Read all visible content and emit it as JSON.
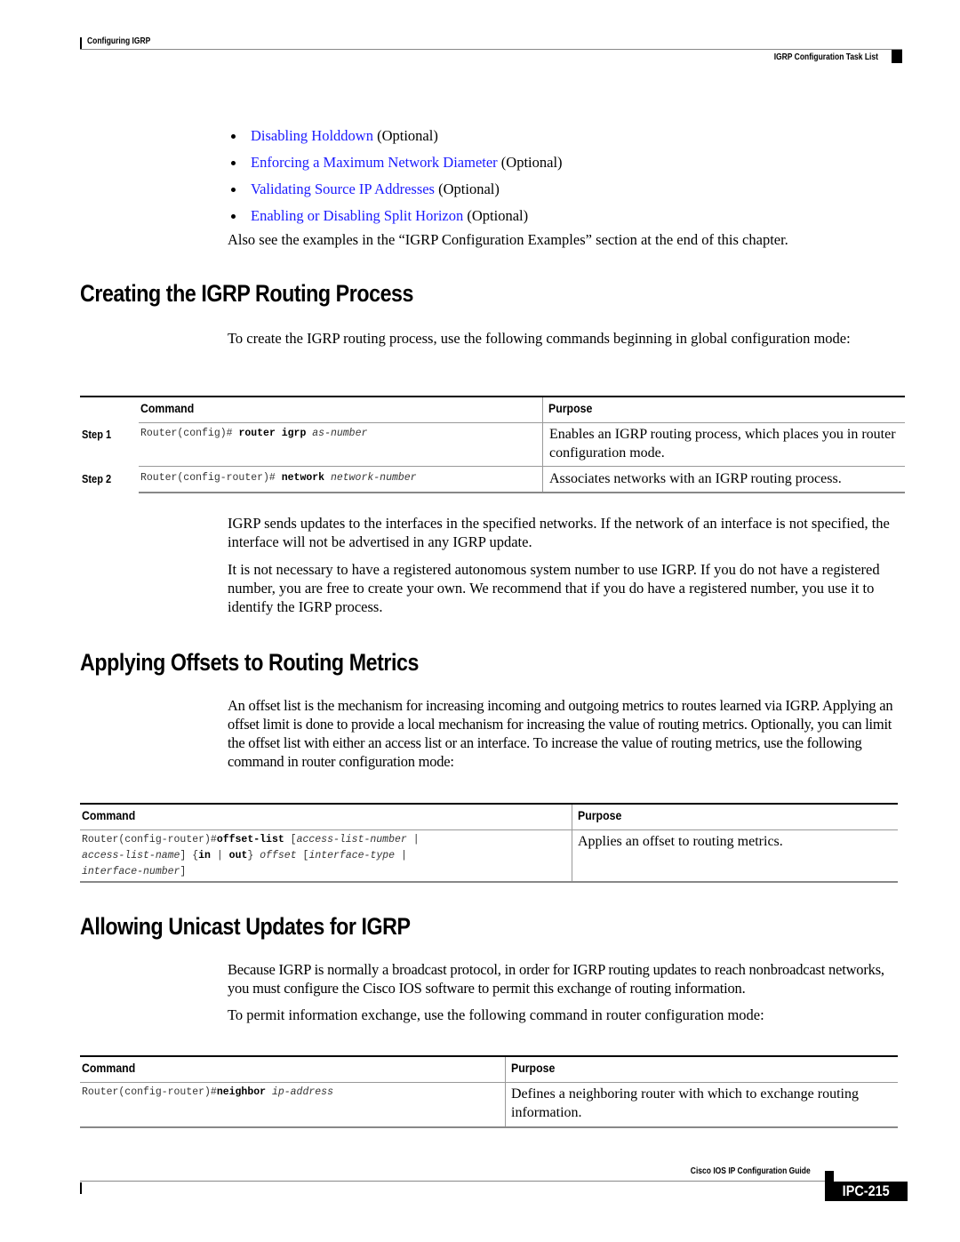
{
  "header": {
    "chapter": "Configuring IGRP",
    "section": "IGRP Configuration Task List"
  },
  "task_list": [
    {
      "link": "Disabling Holddown",
      "suffix": " (Optional)"
    },
    {
      "link": "Enforcing a Maximum Network Diameter",
      "suffix": " (Optional)"
    },
    {
      "link": "Validating Source IP Addresses",
      "suffix": " (Optional)"
    },
    {
      "link": "Enabling or Disabling Split Horizon",
      "suffix": " (Optional)"
    }
  ],
  "intro_note": "Also see the examples in the “IGRP Configuration Examples” section at the end of this chapter.",
  "sections": [
    {
      "title": "Creating the IGRP Routing Process",
      "intro": "To create the IGRP routing process, use the following commands beginning in global configuration mode:",
      "table": {
        "col_command": "Command",
        "col_purpose": "Purpose",
        "rows": [
          {
            "step": "Step 1",
            "prompt": "Router(config)#",
            "keyword": "router igrp",
            "arg": "as-number",
            "purpose": "Enables an IGRP routing process, which places you in router configuration mode."
          },
          {
            "step": "Step 2",
            "prompt": "Router(config-router)#",
            "keyword": "network",
            "arg": "network-number",
            "purpose": "Associates networks with an IGRP routing process."
          }
        ]
      },
      "after": [
        "IGRP sends updates to the interfaces in the specified networks. If the network of an interface is not specified, the interface will not be advertised in any IGRP update.",
        "It is not necessary to have a registered autonomous system number to use IGRP. If you do not have a registered number, you are free to create your own. We recommend that if you do have a registered number, you use it to identify the IGRP process."
      ]
    },
    {
      "title": "Applying Offsets to Routing Metrics",
      "intro": "An offset list is the mechanism for increasing incoming and outgoing metrics to routes learned via IGRP. Applying an offset limit is done to provide a local mechanism for increasing the value of routing metrics. Optionally, you can limit the offset list with either an access list or an interface. To increase the value of routing metrics, use the following command in router configuration mode:",
      "table": {
        "col_command": "Command",
        "col_purpose": "Purpose",
        "rows": [
          {
            "prompt": "Router(config-router)#",
            "keyword": "offset-list",
            "line1_rest": "access-list-number",
            "line2_a": "access-list-name",
            "kw_in": "in",
            "kw_out": "out",
            "arg_offset": "offset",
            "arg_iftype": "interface-type",
            "line3": "interface-number",
            "purpose": "Applies an offset to routing metrics."
          }
        ]
      }
    },
    {
      "title": "Allowing Unicast Updates for IGRP",
      "intro": "Because IGRP is normally a broadcast protocol, in order for IGRP routing updates to reach nonbroadcast networks, you must configure the Cisco IOS software to permit this exchange of routing information.",
      "intro2": "To permit information exchange, use the following command in router configuration mode:",
      "table": {
        "col_command": "Command",
        "col_purpose": "Purpose",
        "rows": [
          {
            "prompt": "Router(config-router)#",
            "keyword": "neighbor",
            "arg": "ip-address",
            "purpose": "Defines a neighboring router with which to exchange routing information."
          }
        ]
      }
    }
  ],
  "footer": {
    "guide_title": "Cisco IOS IP Configuration Guide",
    "page_number": "IPC-215"
  },
  "colors": {
    "link": "#1a1aff",
    "text": "#000000"
  }
}
